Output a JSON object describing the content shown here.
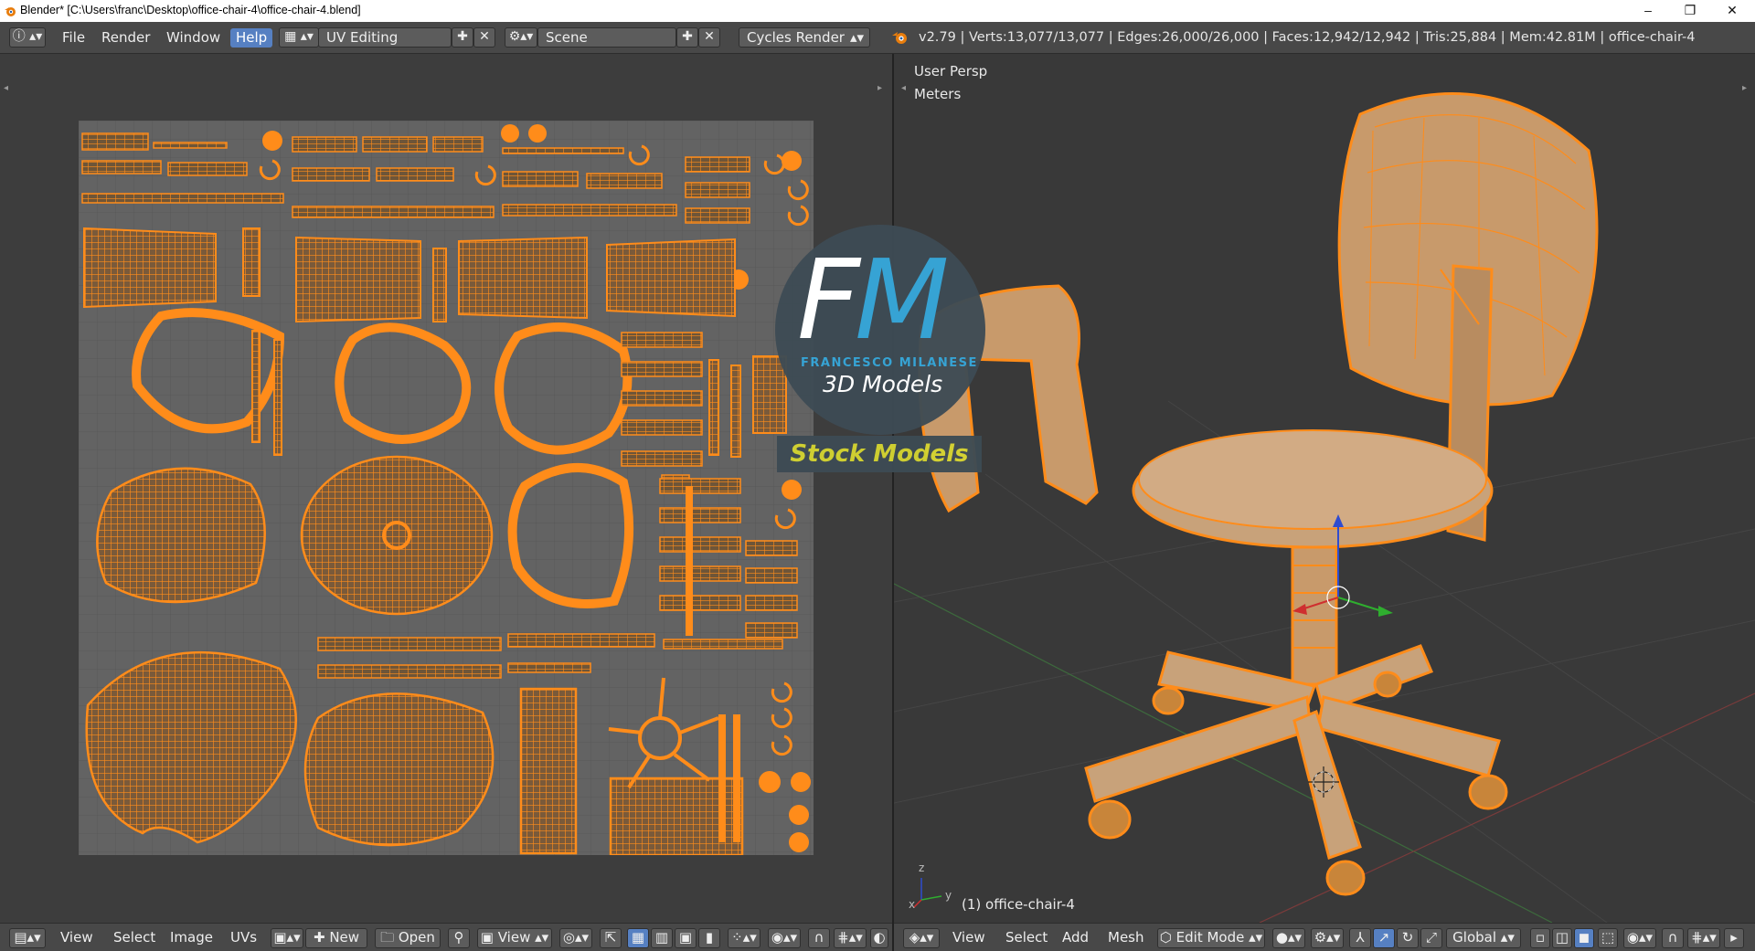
{
  "window": {
    "title": "Blender* [C:\\Users\\franc\\Desktop\\office-chair-4\\office-chair-4.blend]",
    "controls": {
      "minimize": "–",
      "restore": "❐",
      "close": "✕"
    }
  },
  "top_header": {
    "menus": [
      "File",
      "Render",
      "Window",
      "Help"
    ],
    "active_menu": "Help",
    "layout": "UV Editing",
    "scene": "Scene",
    "render_engine": "Cycles Render",
    "stats": "v2.79 | Verts:13,077/13,077 | Edges:26,000/26,000 | Faces:12,942/12,942 | Tris:25,884 | Mem:42.81M | office-chair-4"
  },
  "viewport": {
    "view_label": "User Persp",
    "units_label": "Meters",
    "object_label": "(1) office-chair-4",
    "axis_x": "x",
    "axis_y": "y",
    "axis_z": "z"
  },
  "watermark": {
    "logo": "FM",
    "brand": "FRANCESCO MILANESE",
    "tagline": "3D Models",
    "badge": "Stock Models"
  },
  "uv_footer": {
    "menus": [
      "View",
      "Select",
      "Image",
      "UVs"
    ],
    "new_label": "New",
    "open_label": "Open",
    "view_label": "View"
  },
  "viewport_footer": {
    "menus": [
      "View",
      "Select",
      "Add",
      "Mesh"
    ],
    "mode": "Edit Mode",
    "orientation": "Global"
  },
  "colors": {
    "accent_orange": "#ff8c1a",
    "active_blue": "#5680c2",
    "watermark_blue": "#36a3d4",
    "watermark_yellow": "#d4d431"
  }
}
